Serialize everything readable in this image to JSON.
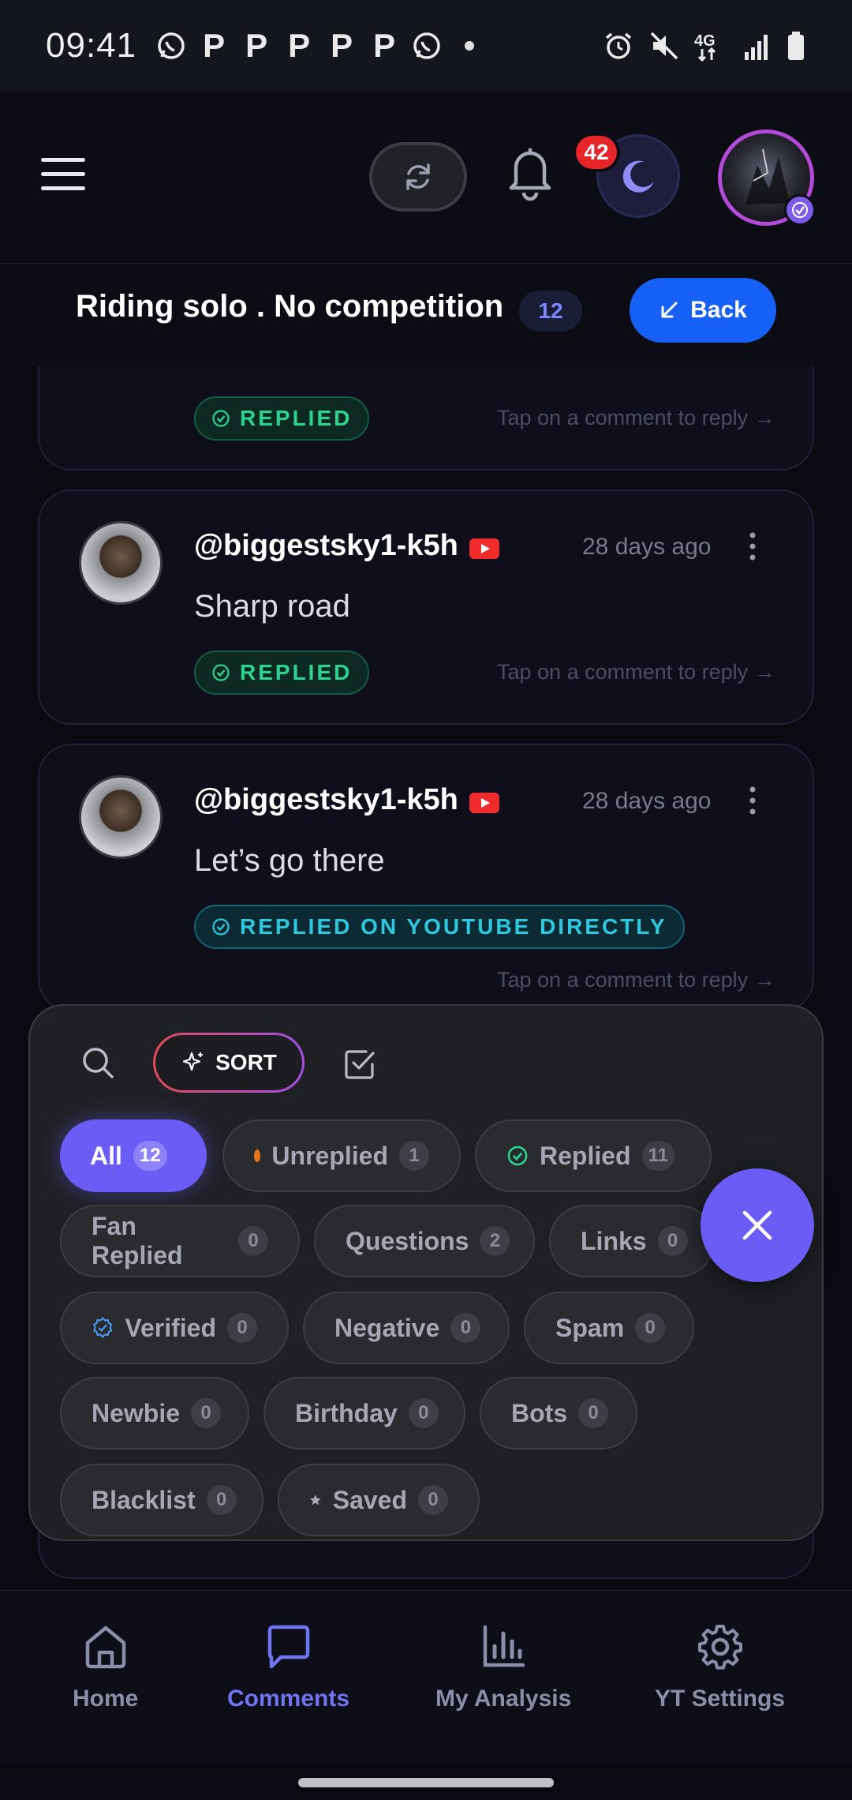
{
  "status_bar": {
    "time": "09:41",
    "notification_glyph": "P"
  },
  "header": {
    "notification_count": "42",
    "colors": {
      "accent": "#6a5cf5",
      "badge": "#e5252a",
      "avatar_ring": "#b44ad9"
    }
  },
  "page": {
    "title": "Riding solo . No competition",
    "count": "12",
    "back_label": "Back"
  },
  "comments": [
    {
      "status": "REPLIED",
      "tap_hint": "Tap on a comment to reply →"
    },
    {
      "username": "@biggestsky1-k5h",
      "time": "28 days ago",
      "text": "Sharp road",
      "status": "REPLIED",
      "tap_hint": "Tap on a comment to reply →"
    },
    {
      "username": "@biggestsky1-k5h",
      "time": "28 days ago",
      "text": "Let’s go there",
      "status": "REPLIED ON YOUTUBE DIRECTLY",
      "tap_hint": "Tap on a comment to reply →"
    }
  ],
  "filter_sheet": {
    "sort_label": "SORT",
    "chips": {
      "all": {
        "label": "All",
        "count": "12"
      },
      "unreplied": {
        "label": "Unreplied",
        "count": "1"
      },
      "replied": {
        "label": "Replied",
        "count": "11"
      },
      "fan_replied": {
        "label": "Fan Replied",
        "count": "0"
      },
      "questions": {
        "label": "Questions",
        "count": "2"
      },
      "links": {
        "label": "Links",
        "count": "0"
      },
      "verified": {
        "label": "Verified",
        "count": "0"
      },
      "negative": {
        "label": "Negative",
        "count": "0"
      },
      "spam": {
        "label": "Spam",
        "count": "0"
      },
      "newbie": {
        "label": "Newbie",
        "count": "0"
      },
      "birthday": {
        "label": "Birthday",
        "count": "0"
      },
      "bots": {
        "label": "Bots",
        "count": "0"
      },
      "blacklist": {
        "label": "Blacklist",
        "count": "0"
      },
      "saved": {
        "label": "Saved",
        "count": "0"
      }
    }
  },
  "bottom_nav": {
    "items": [
      {
        "label": "Home",
        "icon": "home-icon"
      },
      {
        "label": "Comments",
        "icon": "chat-bubble-icon",
        "active": true
      },
      {
        "label": "My Analysis",
        "icon": "bar-chart-icon"
      },
      {
        "label": "YT Settings",
        "icon": "gear-icon"
      }
    ]
  }
}
